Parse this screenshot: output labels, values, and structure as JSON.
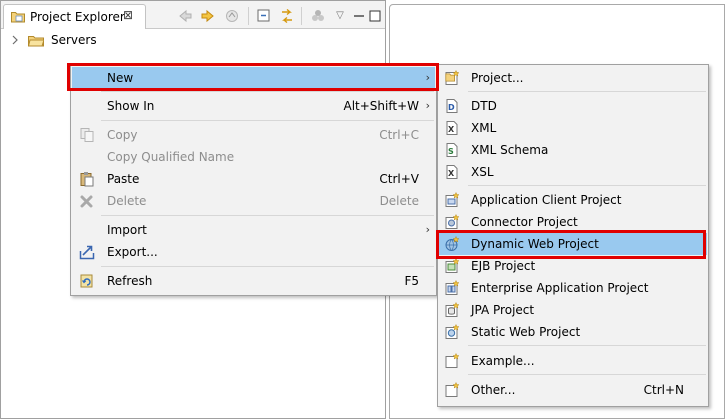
{
  "explorer": {
    "tab_label": "Project Explorer",
    "close_glyph": "⊠",
    "tree": [
      {
        "label": "Servers"
      }
    ]
  },
  "context_menu": {
    "items": [
      {
        "label": "New",
        "shortcut": "",
        "arrow": "›",
        "selected": true
      },
      {
        "label": "Show In",
        "shortcut": "Alt+Shift+W",
        "arrow": "›"
      },
      {
        "label": "Copy",
        "shortcut": "Ctrl+C",
        "disabled": true
      },
      {
        "label": "Copy Qualified Name",
        "shortcut": "",
        "disabled": true
      },
      {
        "label": "Paste",
        "shortcut": "Ctrl+V"
      },
      {
        "label": "Delete",
        "shortcut": "Delete",
        "disabled": true
      },
      {
        "label": "Import",
        "shortcut": "",
        "arrow": "›"
      },
      {
        "label": "Export...",
        "shortcut": ""
      },
      {
        "label": "Refresh",
        "shortcut": "F5"
      }
    ]
  },
  "new_submenu": {
    "items": [
      {
        "label": "Project...",
        "icon": "new-project-icon"
      },
      {
        "label": "DTD",
        "icon": "dtd-file-icon"
      },
      {
        "label": "XML",
        "icon": "xml-file-icon"
      },
      {
        "label": "XML Schema",
        "icon": "xml-schema-icon"
      },
      {
        "label": "XSL",
        "icon": "xsl-file-icon"
      },
      {
        "label": "Application Client Project",
        "icon": "application-client-project-icon"
      },
      {
        "label": "Connector Project",
        "icon": "connector-project-icon"
      },
      {
        "label": "Dynamic Web Project",
        "icon": "dynamic-web-project-icon",
        "selected": true
      },
      {
        "label": "EJB Project",
        "icon": "ejb-project-icon"
      },
      {
        "label": "Enterprise Application Project",
        "icon": "enterprise-application-project-icon"
      },
      {
        "label": "JPA Project",
        "icon": "jpa-project-icon"
      },
      {
        "label": "Static Web Project",
        "icon": "static-web-project-icon"
      },
      {
        "label": "Example...",
        "icon": "example-icon"
      },
      {
        "label": "Other...",
        "icon": "other-wizard-icon",
        "shortcut": "Ctrl+N"
      }
    ]
  },
  "colors": {
    "selection": "#99c9ef",
    "highlight_box": "#e00000",
    "menu_background": "#f2f2f2"
  }
}
